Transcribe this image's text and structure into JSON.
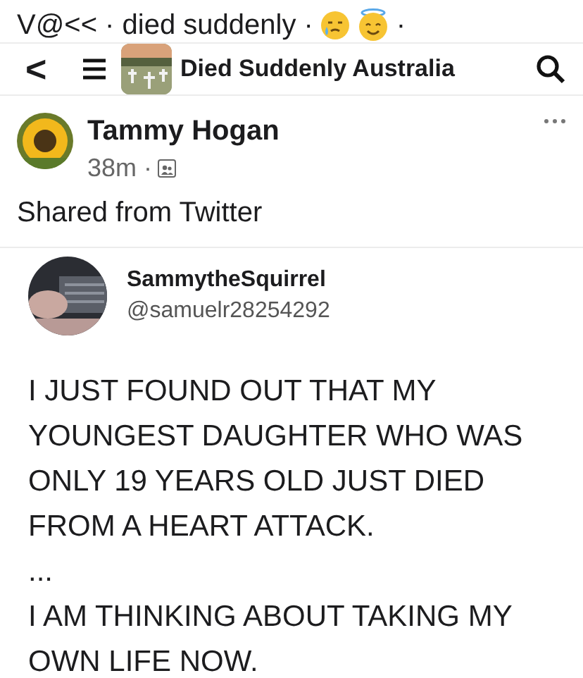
{
  "caption": {
    "prefix": "V@<< · died suddenly ·",
    "suffix": "·"
  },
  "nav": {
    "back": "<",
    "title": "Died Suddenly Australia"
  },
  "post": {
    "author": "Tammy Hogan",
    "time": "38m ·",
    "text": "Shared from Twitter"
  },
  "tweet": {
    "name": "SammytheSquirrel",
    "handle": "@samuelr28254292",
    "lines": [
      "I JUST FOUND OUT THAT MY",
      "YOUNGEST DAUGHTER WHO WAS",
      "ONLY 19 YEARS OLD JUST DIED",
      "FROM A HEART ATTACK.",
      "...",
      "I AM THINKING ABOUT TAKING MY",
      "OWN LIFE NOW."
    ]
  }
}
